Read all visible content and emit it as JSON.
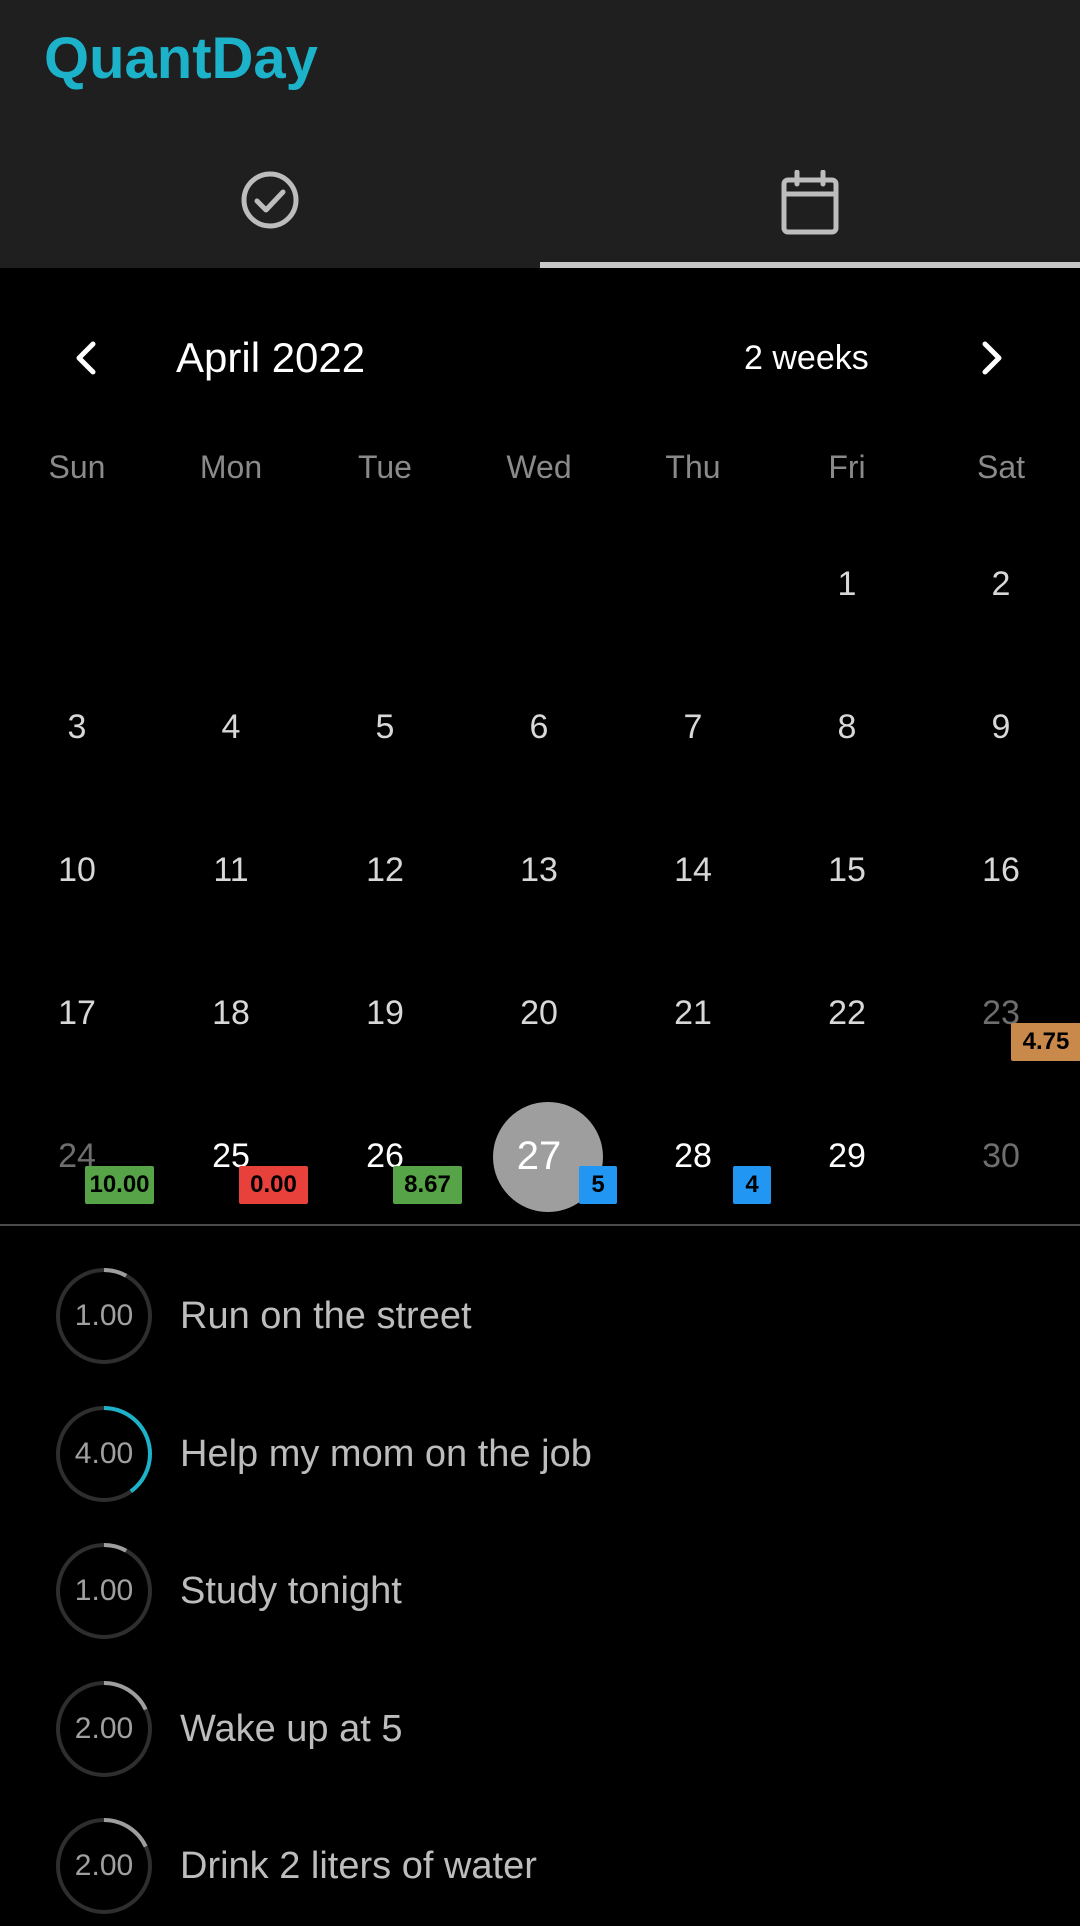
{
  "app": {
    "title": "QuantDay",
    "accent": "#1cb2c9"
  },
  "tabs": [
    {
      "icon": "check-circle-icon",
      "active": false
    },
    {
      "icon": "calendar-icon",
      "active": true
    }
  ],
  "calendar": {
    "month_label": "April 2022",
    "range_label": "2 weeks",
    "weekdays": [
      "Sun",
      "Mon",
      "Tue",
      "Wed",
      "Thu",
      "Fri",
      "Sat"
    ],
    "rows": [
      [
        "",
        "",
        "",
        "",
        "",
        "1",
        "2"
      ],
      [
        "3",
        "4",
        "5",
        "6",
        "7",
        "8",
        "9"
      ],
      [
        "10",
        "11",
        "12",
        "13",
        "14",
        "15",
        "16"
      ],
      [
        "17",
        "18",
        "19",
        "20",
        "21",
        "22",
        "23"
      ],
      [
        "24",
        "25",
        "26",
        "27",
        "28",
        "29",
        "30"
      ]
    ],
    "today": "27",
    "badges": {
      "sat_23": {
        "text": "4.75",
        "color": "#c8894a"
      },
      "sun_24": {
        "text": "10.00",
        "color": "#56a447"
      },
      "mon_25": {
        "text": "0.00",
        "color": "#e8403a"
      },
      "tue_26": {
        "text": "8.67",
        "color": "#56a447"
      },
      "wed_27": {
        "text": "5",
        "color": "#2196f3"
      },
      "thu_28": {
        "text": "4",
        "color": "#2196f3"
      }
    }
  },
  "tasks": [
    {
      "value": "1.00",
      "label": "Run on the street",
      "progress": 0.08,
      "ring_color": "#9e9e9e"
    },
    {
      "value": "4.00",
      "label": "Help my mom on the job",
      "progress": 0.4,
      "ring_color": "#1cb2c9"
    },
    {
      "value": "1.00",
      "label": "Study tonight",
      "progress": 0.08,
      "ring_color": "#9e9e9e"
    },
    {
      "value": "2.00",
      "label": "Wake up at 5",
      "progress": 0.18,
      "ring_color": "#9e9e9e"
    },
    {
      "value": "2.00",
      "label": "Drink 2 liters of water",
      "progress": 0.18,
      "ring_color": "#9e9e9e"
    }
  ]
}
